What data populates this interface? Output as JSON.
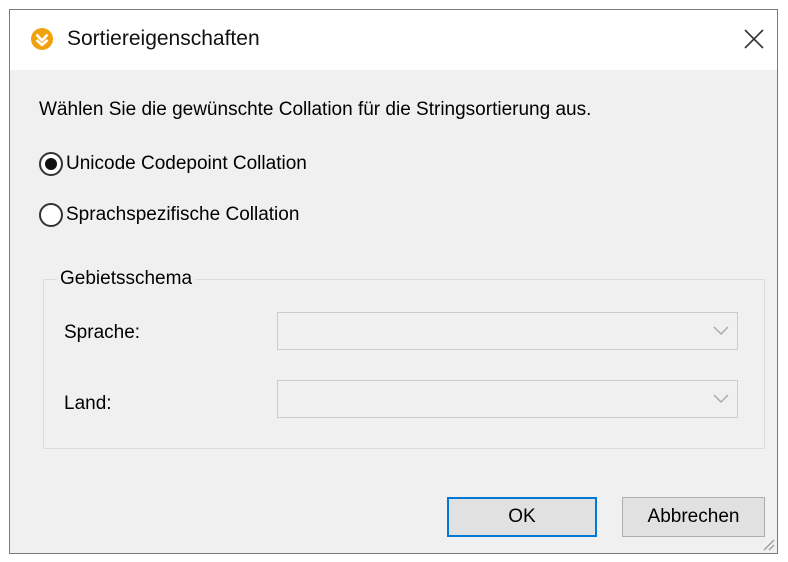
{
  "window": {
    "title": "Sortiereigenschaften",
    "app_icon": "altova-mapforce-icon",
    "close_icon": "close-icon"
  },
  "instruction": "Wählen Sie die gewünschte Collation für die Stringsortierung aus.",
  "collation_options": [
    {
      "label": "Unicode Codepoint Collation",
      "selected": true
    },
    {
      "label": "Sprachspezifische Collation",
      "selected": false
    }
  ],
  "locale_group": {
    "legend": "Gebietsschema",
    "fields": [
      {
        "label": "Sprache:",
        "value": "",
        "enabled": false
      },
      {
        "label": "Land:",
        "value": "",
        "enabled": false
      }
    ]
  },
  "buttons": {
    "ok": "OK",
    "cancel": "Abbrechen"
  },
  "colors": {
    "icon_accent": "#f0a10c",
    "focus_border": "#0078d7",
    "dialog_background": "#f0f0f0"
  }
}
